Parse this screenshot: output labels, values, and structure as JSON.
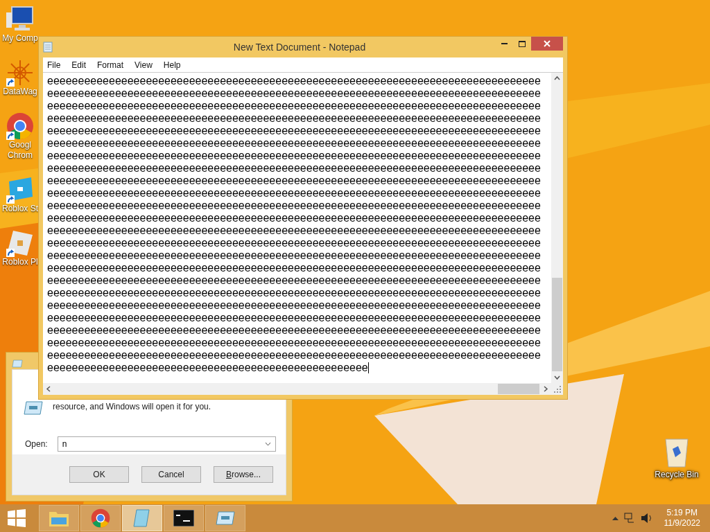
{
  "desktop_icons": [
    {
      "kind": "computer",
      "lines": [
        "My Comp"
      ]
    },
    {
      "kind": "star",
      "lines": [
        "DataWag"
      ]
    },
    {
      "kind": "chrome",
      "lines": [
        "Googl",
        "Chrom"
      ]
    },
    {
      "kind": "studio",
      "lines": [
        "Roblox St"
      ]
    },
    {
      "kind": "player",
      "lines": [
        "Roblox Pl"
      ]
    }
  ],
  "recycle_bin": {
    "label": "Recycle Bin"
  },
  "run_dialog": {
    "description": "resource, and Windows will open it for you.",
    "open_label": "Open:",
    "open_value": "n",
    "buttons": [
      {
        "label": "OK",
        "underline_first": false
      },
      {
        "label": "Cancel",
        "underline_first": false
      },
      {
        "label": "Browse...",
        "underline_first": true
      }
    ]
  },
  "notepad": {
    "title": "New Text Document - Notepad",
    "menu": [
      "File",
      "Edit",
      "Format",
      "View",
      "Help"
    ],
    "lines": [
      "eeeeeeeeeeeeeeeeeeeeeeeeeeeeeeeeeeeeeeeeeeeeeeeeeeeeeeeeeeeeeeeeeeeeeeeeeeeeeeee",
      "eeeeeeeeeeeeeeeeeeeeeeeeeeeeeeeeeeeeeeeeeeeeeeeeeeeeeeeeeeeeeeeeeeeeeeeeeeeeeeee",
      "eeeeeeeeeeeeeeeeeeeeeeeeeeeeeeeeeeeeeeeeeeeeeeeeeeeeeeeeeeeeeeeeeeeeeeeeeeeeeeee",
      "eeeeeeeeeeeeeeeeeeeeeeeeeeeeeeeeeeeeeeeeeeeeeeeeeeeeeeeeeeeeeeeeeeeeeeeeeeeeeeee",
      "eeeeeeeeeeeeeeeeeeeeeeeeeeeeeeeeeeeeeeeeeeeeeeeeeeeeeeeeeeeeeeeeeeeeeeeeeeeeeeee",
      "eeeeeeeeeeeeeeeeeeeeeeeeeeeeeeeeeeeeeeeeeeeeeeeeeeeeeeeeeeeeeeeeeeeeeeeeeeeeeeee",
      "eeeeeeeeeeeeeeeeeeeeeeeeeeeeeeeeeeeeeeeeeeeeeeeeeeeeeeeeeeeeeeeeeeeeeeeeeeeeeeee",
      "eeeeeeeeeeeeeeeeeeeeeeeeeeeeeeeeeeeeeeeeeeeeeeeeeeeeeeeeeeeeeeeeeeeeeeeeeeeeeeee",
      "eeeeeeeeeeeeeeeeeeeeeeeeeeeeeeeeeeeeeeeeeeeeeeeeeeeeeeeeeeeeeeeeeeeeeeeeeeeeeeee",
      "eeeeeeeeeeeeeeeeeeeeeeeeeeeeeeeeeeeeeeeeeeeeeeeeeeeeeeeeeeeeeeeeeeeeeeeeeeeeeeee",
      "eeeeeeeeeeeeeeeeeeeeeeeeeeeeeeeeeeeeeeeeeeeeeeeeeeeeeeeeeeeeeeeeeeeeeeeeeeeeeeee",
      "eeeeeeeeeeeeeeeeeeeeeeeeeeeeeeeeeeeeeeeeeeeeeeeeeeeeeeeeeeeeeeeeeeeeeeeeeeeeeeee",
      "eeeeeeeeeeeeeeeeeeeeeeeeeeeeeeeeeeeeeeeeeeeeeeeeeeeeeeeeeeeeeeeeeeeeeeeeeeeeeeee",
      "eeeeeeeeeeeeeeeeeeeeeeeeeeeeeeeeeeeeeeeeeeeeeeeeeeeeeeeeeeeeeeeeeeeeeeeeeeeeeeee",
      "eeeeeeeeeeeeeeeeeeeeeeeeeeeeeeeeeeeeeeeeeeeeeeeeeeeeeeeeeeeeeeeeeeeeeeeeeeeeeeee",
      "eeeeeeeeeeeeeeeeeeeeeeeeeeeeeeeeeeeeeeeeeeeeeeeeeeeeeeeeeeeeeeeeeeeeeeeeeeeeeeee",
      "eeeeeeeeeeeeeeeeeeeeeeeeeeeeeeeeeeeeeeeeeeeeeeeeeeeeeeeeeeeeeeeeeeeeeeeeeeeeeeee",
      "eeeeeeeeeeeeeeeeeeeeeeeeeeeeeeeeeeeeeeeeeeeeeeeeeeeeeeeeeeeeeeeeeeeeeeeeeeeeeeee",
      "eeeeeeeeeeeeeeeeeeeeeeeeeeeeeeeeeeeeeeeeeeeeeeeeeeeeeeeeeeeeeeeeeeeeeeeeeeeeeeee",
      "eeeeeeeeeeeeeeeeeeeeeeeeeeeeeeeeeeeeeeeeeeeeeeeeeeeeeeeeeeeeeeeeeeeeeeeeeeeeeeee",
      "eeeeeeeeeeeeeeeeeeeeeeeeeeeeeeeeeeeeeeeeeeeeeeeeeeeeeeeeeeeeeeeeeeeeeeeeeeeeeeee",
      "eeeeeeeeeeeeeeeeeeeeeeeeeeeeeeeeeeeeeeeeeeeeeeeeeeeeeeeeeeeeeeeeeeeeeeeeeeeeeeee",
      "eeeeeeeeeeeeeeeeeeeeeeeeeeeeeeeeeeeeeeeeeeeeeeeeeeeeeeeeeeeeeeeeeeeeeeeeeeeeeeee",
      "eeeeeeeeeeeeeeeeeeeeeeeeeeeeeeeeeeeeeeeeeeeeeeeeeeee"
    ]
  },
  "taskbar": {
    "apps": [
      {
        "kind": "explorer",
        "active": false
      },
      {
        "kind": "chrome",
        "active": false
      },
      {
        "kind": "notepad",
        "active": true
      },
      {
        "kind": "cmd",
        "active": false
      },
      {
        "kind": "run",
        "active": false
      }
    ],
    "time": "5:19 PM",
    "date": "11/9/2022"
  }
}
